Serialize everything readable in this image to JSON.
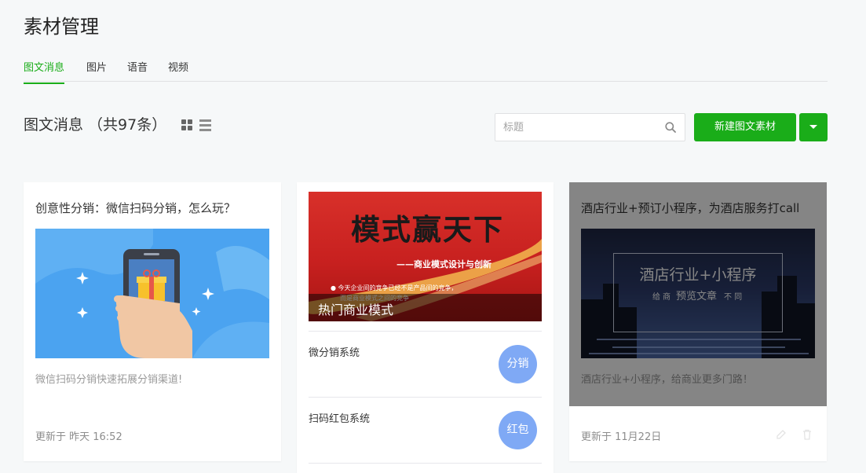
{
  "header": {
    "title": "素材管理"
  },
  "tabs": [
    {
      "label": "图文消息",
      "active": true
    },
    {
      "label": "图片",
      "active": false
    },
    {
      "label": "语音",
      "active": false
    },
    {
      "label": "视频",
      "active": false
    }
  ],
  "section": {
    "title": "图文消息 （共97条）"
  },
  "search": {
    "placeholder": "标题",
    "value": ""
  },
  "toolbar": {
    "new_label": "新建图文素材"
  },
  "icons": [
    "grid-view-icon",
    "list-view-icon",
    "search-icon",
    "caret-down-icon"
  ],
  "colors": {
    "accent": "#1aad19",
    "badge": "#7fa9f5"
  },
  "cards": [
    {
      "title": "创意性分销：微信扫码分销，怎么玩？",
      "image_label": "buy",
      "desc": "微信扫码分销快速拓展分销渠道!",
      "time": "更新于 昨天 16:52"
    },
    {
      "banner": {
        "headline": "模式赢天下",
        "subtitle": "——商业模式设计与创新",
        "line1": "● 今天企业间的竞争已经不是产品间的竞争，",
        "line2": "而是商业模式之间的竞争",
        "caption": "热门商业模式"
      },
      "items": [
        {
          "title": "微分销系统",
          "badge": "分销"
        },
        {
          "title": "扫码红包系统",
          "badge": "红包"
        }
      ]
    },
    {
      "title": "酒店行业+预订小程序，为酒店服务打call",
      "image_headline": "酒店行业+小程序",
      "image_sub_left": "给 商",
      "image_preview": "预览文章",
      "image_sub_right": "不 同",
      "desc": "酒店行业+小程序，给商业更多门路！",
      "time": "更新于 11月22日"
    }
  ]
}
